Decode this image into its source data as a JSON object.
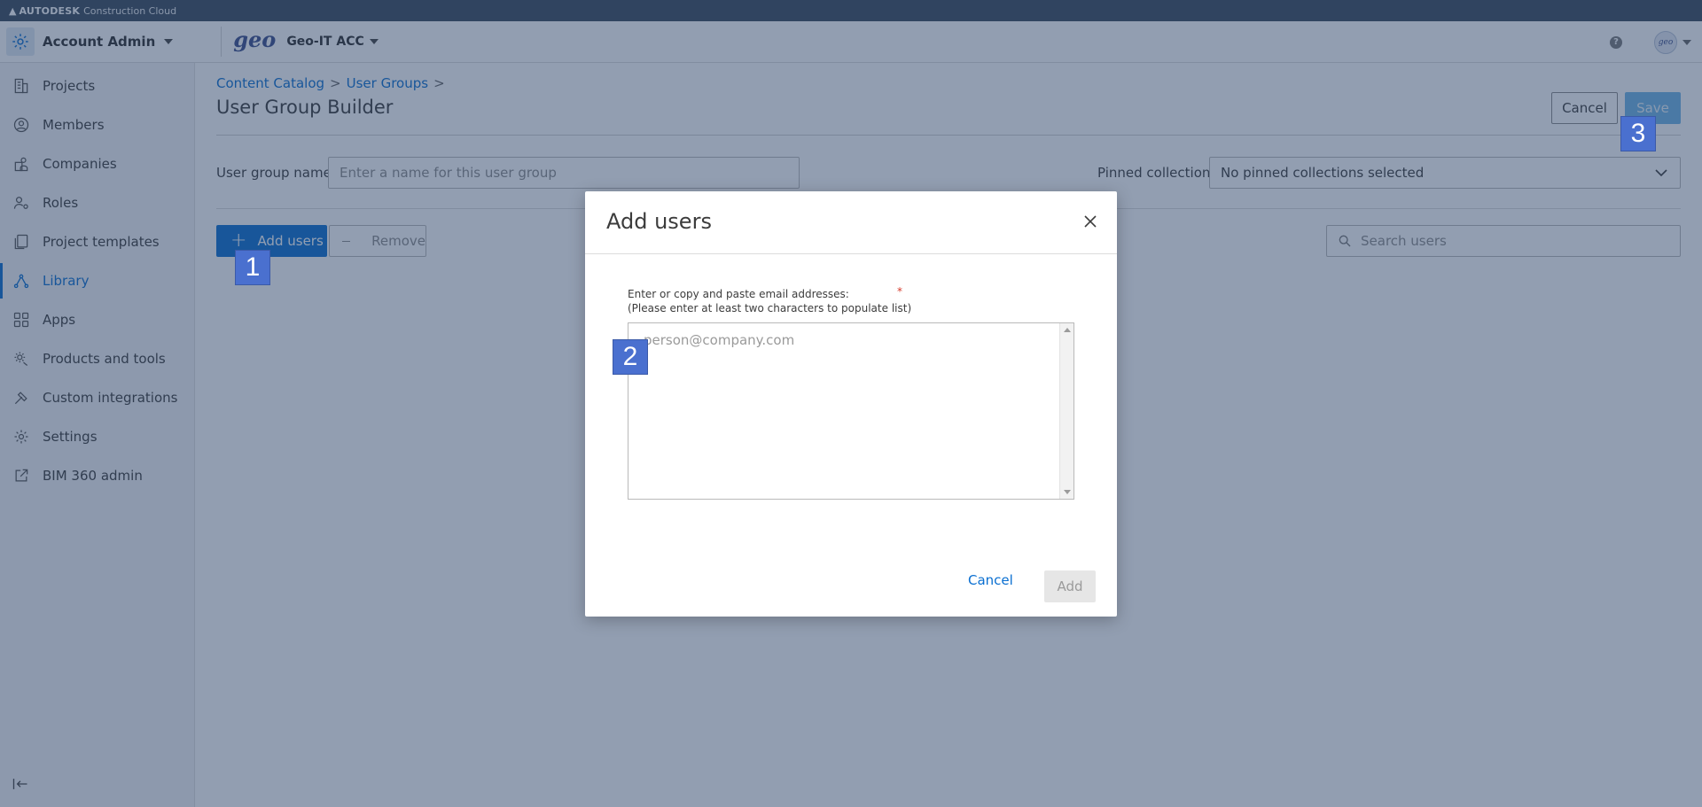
{
  "brand": {
    "strong": "AUTODESK",
    "light": "Construction Cloud"
  },
  "header": {
    "account_title": "Account Admin",
    "logo_text": "geo",
    "project_name": "Geo-IT ACC",
    "help_glyph": "?",
    "avatar_text": "geo"
  },
  "sidebar": {
    "items": [
      {
        "label": "Projects",
        "icon": "building-icon"
      },
      {
        "label": "Members",
        "icon": "person-circle-icon"
      },
      {
        "label": "Companies",
        "icon": "companies-icon"
      },
      {
        "label": "Roles",
        "icon": "person-gear-icon"
      },
      {
        "label": "Project templates",
        "icon": "templates-icon"
      },
      {
        "label": "Library",
        "icon": "library-icon",
        "active": true
      },
      {
        "label": "Apps",
        "icon": "apps-grid-icon"
      },
      {
        "label": "Products and tools",
        "icon": "gear-tools-icon"
      },
      {
        "label": "Custom integrations",
        "icon": "hammer-icon"
      },
      {
        "label": "Settings",
        "icon": "gear-icon"
      },
      {
        "label": "BIM 360 admin",
        "icon": "external-link-icon"
      }
    ]
  },
  "main": {
    "breadcrumb": [
      "Content Catalog",
      "User Groups"
    ],
    "breadcrumb_sep": ">",
    "title": "User Group Builder",
    "cancel_label": "Cancel",
    "save_label": "Save",
    "user_group_name_label": "User group name",
    "required_mark": "*",
    "user_group_name_placeholder": "Enter a name for this user group",
    "pinned_label": "Pinned collections",
    "pinned_value": "No pinned collections selected",
    "add_users_label": "Add users",
    "remove_label": "Remove",
    "search_placeholder": "Search users"
  },
  "modal": {
    "title": "Add users",
    "instruction_line1": "Enter or copy and paste email addresses:",
    "instruction_line2": "(Please enter at least two characters to populate list)",
    "required_mark": "*",
    "email_placeholder": "person@company.com",
    "cancel_label": "Cancel",
    "add_label": "Add"
  },
  "markers": [
    "1",
    "2",
    "3"
  ],
  "colors": {
    "accent": "#0a6fd1",
    "save_disabled": "#6fb4e6",
    "required": "#d63b2c",
    "marker": "#4a70cf",
    "brand_bar": "#3b4a5c"
  }
}
